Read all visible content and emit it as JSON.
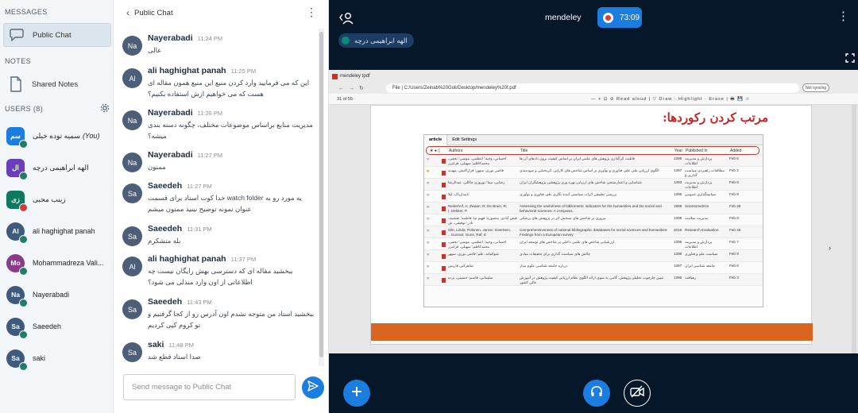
{
  "sidebar": {
    "messages_title": "MESSAGES",
    "public_chat_label": "Public Chat",
    "notes_title": "NOTES",
    "shared_notes_label": "Shared Notes",
    "users_title": "USERS (8)",
    "users": [
      {
        "initials": "سم",
        "name": "سمیه توده خیلی",
        "you": "(You)",
        "color": "#1b7de0",
        "shape": "square",
        "badge": "green"
      },
      {
        "initials": "ال",
        "name": "الهه ابراهیمی درچه",
        "color": "#6a3dbd",
        "shape": "square",
        "badge": "green"
      },
      {
        "initials": "زی",
        "name": "زینب محبی",
        "color": "#0d7a5f",
        "shape": "square",
        "badge": "red"
      },
      {
        "initials": "Al",
        "name": "ali haghighat panah",
        "color": "#3e5a7e",
        "shape": "round",
        "badge": "green"
      },
      {
        "initials": "Mo",
        "name": "Mohammadreza Vali...",
        "color": "#8a3c8a",
        "shape": "round",
        "badge": "green"
      },
      {
        "initials": "Na",
        "name": "Nayerabadi",
        "color": "#3e5a7e",
        "shape": "round",
        "badge": "green"
      },
      {
        "initials": "Sa",
        "name": "Saeedeh",
        "color": "#3e5a7e",
        "shape": "round",
        "badge": "green"
      },
      {
        "initials": "Sa",
        "name": "saki",
        "color": "#3e5a7e",
        "shape": "round",
        "badge": "green"
      }
    ]
  },
  "chat": {
    "title": "Public Chat",
    "input_placeholder": "Send message to Public Chat",
    "messages": [
      {
        "initials": "Na",
        "name": "Nayerabadi",
        "time": "11:24 PM",
        "text": "عالی",
        "rtl": true
      },
      {
        "initials": "Al",
        "name": "ali haghighat panah",
        "time": "11:25 PM",
        "text": "این که می فرمایید وارد کردن منبع این منبع همون مقاله ای هست که می خواهیم ازش استفاده بکنیم؟",
        "rtl": true
      },
      {
        "initials": "Na",
        "name": "Nayerabadi",
        "time": "11:26 PM",
        "text": "مدیریت منابع براساس موضوعات مختلف، چگونه دسته بندی میشه؟",
        "rtl": true
      },
      {
        "initials": "Na",
        "name": "Nayerabadi",
        "time": "11:27 PM",
        "text": "ممنون",
        "rtl": true
      },
      {
        "initials": "Sa",
        "name": "Saeedeh",
        "time": "11:27 PM",
        "text": "یه مورد رو به watch folder خدا کوت استاد برای قسمت عنوان نمونه توضیح نبنید ممنون میشم",
        "rtl": true
      },
      {
        "initials": "Sa",
        "name": "Saeedeh",
        "time": "11:31 PM",
        "text": "بله متشکرم",
        "rtl": true
      },
      {
        "initials": "Al",
        "name": "ali haghighat panah",
        "time": "11:37 PM",
        "text": "ببخشید مقاله ای که دسترسی بهش رایگان نیست چه اطلاعاتی از اون وارد منذلی می شود؟",
        "rtl": true
      },
      {
        "initials": "Sa",
        "name": "Saeedeh",
        "time": "11:43 PM",
        "text": "ببخشید استاد من متوجه نشدم اون آدرس رو از کجا گرفتیم و تو کروم کپی کردیم",
        "rtl": true
      },
      {
        "initials": "Sa",
        "name": "saki",
        "time": "11:48 PM",
        "text": "صدا استاد قطع شد",
        "rtl": true
      }
    ]
  },
  "stage": {
    "title": "mendeley",
    "rec_time": "73:09",
    "talker": "الهه ابراهیمی درچه"
  },
  "slide": {
    "tab_title": "mendeley tpdf",
    "address": "File | C:/Users/Zeinab%20Goli/Desktop/mendeley%20f.pdf",
    "sync": "Not syncing",
    "page_counter": "31  of 55",
    "tools": "—  +  ⊡  ⊘  Read aloud  |  ▽ Draw  ·  Highlight  ·  Erase  |  🖶  💾  ☆",
    "heading": "مرتب کردن رکوردها:",
    "tab_article": "article",
    "tab_edit": "Edit Settings",
    "cols": {
      "authors": "Authors",
      "title": "Title",
      "year": "Year",
      "published": "Published In",
      "added": "Added"
    },
    "rows": [
      {
        "star": false,
        "authors": "احسانی، وحید؛ اعظمی، موسی؛ نجفی، محمدکاظم؛ سهیلی، فرامرز",
        "title": "قابلیت اثرگذاری پژوهش های علمی ایران بر اساس کیفیت برون دادهای آن ها",
        "title_ltr": false,
        "year": "1396",
        "pub": "پردازش و مدیریت اطلاعات",
        "pub_ltr": false,
        "added": "Feb 6"
      },
      {
        "star": true,
        "authors": "قاضی نوری، سپهر؛ فراراکیش، مهدیه",
        "title": "الگوی ارزیابی ملی علم، فناوری و نوآوری بر اساس شاخص های کارایی، اثربخشی و سودمندی",
        "title_ltr": false,
        "year": "1397",
        "pub": "مطالعات راهبردی سیاست گذاری ع",
        "pub_ltr": false,
        "added": "Feb 2"
      },
      {
        "star": false,
        "authors": "رضایی، مینا؛ نوروزی چاکلی، عبدالرضا",
        "title": "شناسایی و اعتبارسنجی شاخص های ارزیابی بهره وری پژوهشی پژوهشگران ایران",
        "title_ltr": false,
        "year": "1393",
        "pub": "پردازش و مدیریت اطلاعات",
        "pub_ltr": false,
        "added": "Feb 6"
      },
      {
        "star": false,
        "authors": "نامدارپاک، لیلا",
        "title": "بررسی تطبیقی اثرات سیاستی آینده نگاری علم، فناوری و نوآوری",
        "title_ltr": false,
        "year": "1396",
        "pub": "سیاستگذاری عمومی",
        "pub_ltr": false,
        "added": "Feb 9"
      },
      {
        "star": false,
        "authors": "Nederhof, A; Zwaan, R; De Bruin, R; Dekker, P. )",
        "title": "Assessing the usefulness of bibliometric indicators for the humanities and the social and behavioral sciences: A comparat...",
        "title_ltr": true,
        "year": "1989",
        "pub": "Scientometrics",
        "pub_ltr": true,
        "added": "Feb 28"
      },
      {
        "star": false,
        "authors": "فیض آبادی، منصوره؛ فهیم نیا، فاطمه؛ نقشینه، نادر؛ توفیقی، ش",
        "title": "مروری بر شاخص های سنجش اثر در پژوهش های پزشکی",
        "title_ltr": false,
        "year": "1395",
        "pub": "مدیریت سلامت",
        "pub_ltr": false,
        "added": "Feb 6"
      },
      {
        "star": false,
        "authors": "Sile, Linda; Polonen, Janne; Sivertsen, Gunnar; Guns, Raf; E...",
        "title": "Comprehensiveness of national bibliographic databases for social sciences and humanities: Findings from a European survey",
        "title_ltr": true,
        "year": "2018",
        "pub": "Research Evaluation",
        "pub_ltr": true,
        "added": "Feb 28"
      },
      {
        "star": false,
        "authors": "احسانی، وحید؛ اعظمی، موسی؛ نجفی، محمدکاظم؛ سهیلی، فرامرز",
        "title": "ارزشیابی شاخص های علمی داخلی بر شاخص های توسعه ایران",
        "title_ltr": false,
        "year": "1395",
        "pub": "پردازش و مدیریت اطلاعات",
        "pub_ltr": false,
        "added": "Feb 7"
      },
      {
        "star": false,
        "authors": "شوکتیاند، علم؛ قاضی نوری، سپهر",
        "title": "چالش های سیاست گذاری برای تحقیقات بنیادی",
        "title_ltr": false,
        "year": "1398",
        "pub": "سیاست علم و فناوری",
        "pub_ltr": false,
        "added": "Feb 9"
      },
      {
        "star": false,
        "authors": "شاهرکنی فاریس",
        "title": "درباره جامعه شناسی علوم مدار",
        "title_ltr": false,
        "year": "1387",
        "pub": "جامعه شناسی ایران",
        "pub_ltr": false,
        "added": "Feb 6"
      },
      {
        "star": false,
        "authors": "سلیمانی، قاسم؛ حسینی، نرده",
        "title": "تبیین چارچوب تحلیلی پژوهش: گامی به سوی ارائه الگوی نظام ارزیابی کیفیت پژوهش در آموزش عالی کشور",
        "title_ltr": false,
        "year": "1396",
        "pub": "رهیافت",
        "pub_ltr": false,
        "added": "Feb 3"
      }
    ]
  },
  "colors": {
    "accent": "#1b7de0",
    "stage_bg": "#06172a",
    "record_red": "#e23a3a",
    "heading_red": "#c72323",
    "band_orange": "#d9651f"
  }
}
